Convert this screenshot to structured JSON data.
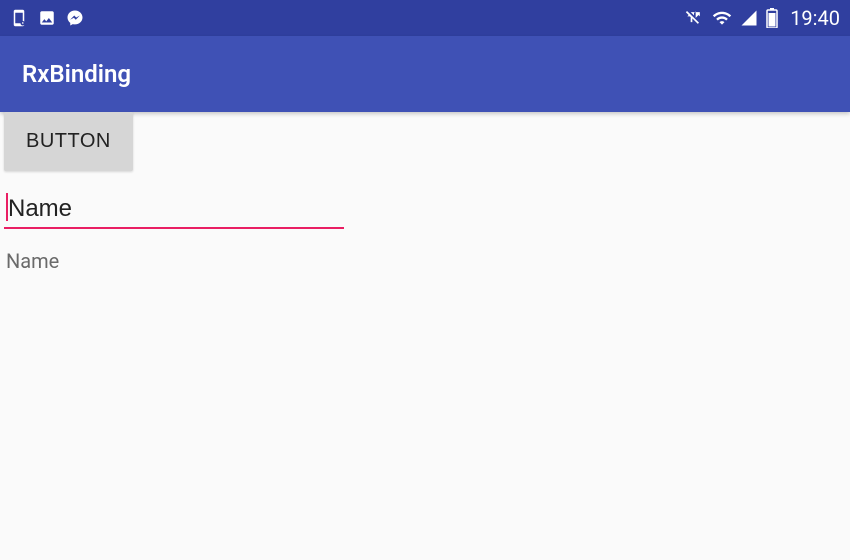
{
  "status_bar": {
    "clock": "19:40"
  },
  "app_bar": {
    "title": "RxBinding"
  },
  "main": {
    "button_label": "BUTTON",
    "name_field_value": "Name",
    "name_field_placeholder": "Name",
    "output_text": "Name"
  },
  "colors": {
    "primary": "#3f51b5",
    "primary_dark": "#303f9f",
    "accent": "#e91e63"
  }
}
